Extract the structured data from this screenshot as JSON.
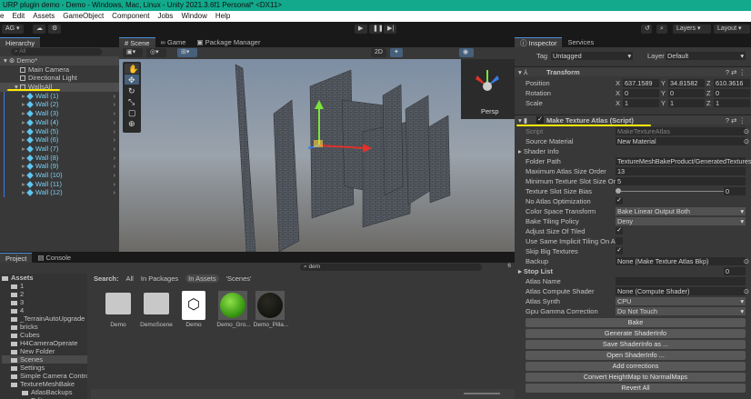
{
  "window": {
    "title": "URP plugin demo - Demo - Windows, Mac, Linux - Unity 2021.3.6f1 Personal* <DX11>"
  },
  "menu": [
    "e",
    "Edit",
    "Assets",
    "GameObject",
    "Component",
    "Jobs",
    "Window",
    "Help"
  ],
  "toolbar": {
    "account": "AG ▾",
    "layers": "Layers",
    "layout": "Layout"
  },
  "hierarchy": {
    "tab": "Hierarchy",
    "search_placeholder": "All",
    "scene": "Demo*",
    "items": [
      "Main Camera",
      "Directional Light",
      "WallsAll"
    ],
    "walls": [
      "Wall (1)",
      "Wall (2)",
      "Wall (3)",
      "Wall (4)",
      "Wall (5)",
      "Wall (6)",
      "Wall (7)",
      "Wall (8)",
      "Wall (9)",
      "Wall (10)",
      "Wall (11)",
      "Wall (12)"
    ]
  },
  "scene": {
    "tabs": [
      "Scene",
      "Game",
      "Package Manager"
    ],
    "mode_2d": "2D",
    "persp": "Persp"
  },
  "inspector": {
    "tabs": [
      "Inspector",
      "Services"
    ],
    "tag_label": "Tag",
    "tag": "Untagged",
    "layer_label": "Layer",
    "layer": "Default",
    "transform": {
      "title": "Transform",
      "position": [
        "637.1589",
        "34.81582",
        "610.3616"
      ],
      "rotation": [
        "0",
        "0",
        "0"
      ],
      "scale": [
        "1",
        "1",
        "1"
      ],
      "labels": [
        "Position",
        "Rotation",
        "Scale"
      ],
      "axes": [
        "X",
        "Y",
        "Z"
      ]
    },
    "component": {
      "title": "Make Texture Atlas (Script)",
      "fields": [
        {
          "label": "Script",
          "value": "MakeTextureAtlas",
          "type": "obj"
        },
        {
          "label": "Source Material",
          "value": "New Material",
          "type": "obj"
        },
        {
          "label": "Shader Info",
          "type": "fold"
        },
        {
          "label": "Folder Path",
          "value": "TextureMeshBakeProduct/GeneratedTextures",
          "type": "text"
        },
        {
          "label": "Maximum Atlas Size Order",
          "value": "13",
          "type": "text"
        },
        {
          "label": "Minimum Texture Slot Size Ord",
          "value": "5",
          "type": "text"
        },
        {
          "label": "Texture Slot Size Bias",
          "value": "0",
          "type": "slider"
        },
        {
          "label": "No Atlas Optimization",
          "value": true,
          "type": "check"
        },
        {
          "label": "Color Space Transform",
          "value": "Bake Linear Output Both",
          "type": "dd"
        },
        {
          "label": "Bake Tiling Policy",
          "value": "Deny",
          "type": "dd"
        },
        {
          "label": "Adjust Size Of Tiled",
          "value": true,
          "type": "check"
        },
        {
          "label": "Use Same Implicit Tiling On All",
          "value": false,
          "type": "check"
        },
        {
          "label": "Skip Big Textures",
          "value": true,
          "type": "check"
        },
        {
          "label": "Backup",
          "value": "None (Make Texture Atlas Bkp)",
          "type": "obj"
        },
        {
          "label": "Stop List",
          "value": "0",
          "type": "foldnum"
        },
        {
          "label": "Atlas Name",
          "value": "",
          "type": "text"
        },
        {
          "label": "Atlas Compute Shader",
          "value": "None (Compute Shader)",
          "type": "obj"
        },
        {
          "label": "Atlas Synth",
          "value": "CPU",
          "type": "dd"
        },
        {
          "label": "Gpu Gamma Correction",
          "value": "Do Not Touch",
          "type": "dd"
        }
      ],
      "buttons": [
        "Bake",
        "Generate ShaderInfo",
        "Save ShaderInfo as ...",
        "Open ShaderInfo ...",
        "Add corrections",
        "Convert HeightMap to NormalMaps",
        "Revert All"
      ]
    }
  },
  "project": {
    "tabs": [
      "Project",
      "Console"
    ],
    "search": "dem",
    "search_label": "Search:",
    "filters": [
      "All",
      "In Packages",
      "In Assets",
      "'Scenes'"
    ],
    "tree": [
      "Assets",
      "1",
      "2",
      "3",
      "4",
      "_TerrainAutoUpgrade",
      "bricks",
      "Cubes",
      "H4CameraOperate",
      "New Folder",
      "Scenes",
      "Settings",
      "Simple Camera Controller",
      "TextureMeshBake",
      "AtlasBackups",
      "Editor"
    ],
    "assets": [
      "Demo",
      "DemoScene",
      "Demo",
      "Demo_Gro...",
      "Demo_Pilla..."
    ],
    "count": "6"
  },
  "colors": {
    "accent": "#4a8fd6",
    "title": "#12a98c",
    "highlight": "#ffea00"
  }
}
